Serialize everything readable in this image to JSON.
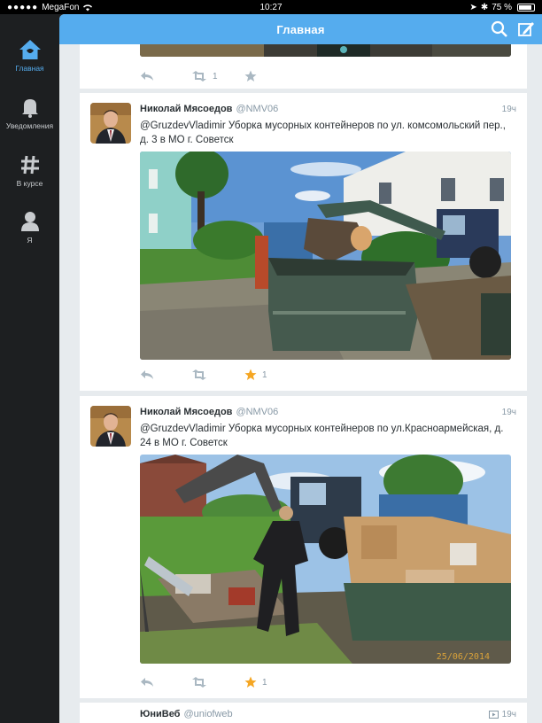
{
  "status_bar": {
    "carrier": "MegaFon",
    "time": "10:27",
    "battery": "75 %",
    "battery_level": 0.75
  },
  "sidebar": {
    "items": [
      {
        "label": "Главная",
        "icon": "home-icon",
        "active": true
      },
      {
        "label": "Уведомления",
        "icon": "bell-icon",
        "active": false
      },
      {
        "label": "В курсе",
        "icon": "hashtag-icon",
        "active": false
      },
      {
        "label": "Я",
        "icon": "person-icon",
        "active": false
      }
    ]
  },
  "header": {
    "title": "Главная",
    "icons": [
      "search-icon",
      "compose-icon"
    ]
  },
  "timeline": {
    "top_tweet": {
      "retweets": "1"
    },
    "tweets": [
      {
        "author": "Николай Мясоедов",
        "handle": "@NMV06",
        "time": "19ч",
        "text": "@GruzdevVladimir  Уборка мусорных контейнеров по ул. комсомольский пер., д. 3 в МО г. Советск",
        "favorites": "1"
      },
      {
        "author": "Николай Мясоедов",
        "handle": "@NMV06",
        "time": "19ч",
        "text": "@GruzdevVladimir  Уборка мусорных контейнеров по ул.Красноармейская, д. 24 в МО г. Советск",
        "favorites": "1",
        "photo_date": "25/06/2014"
      }
    ],
    "bottom_tweet": {
      "author": "ЮниВеб",
      "handle": "@uniofweb",
      "time": "19ч"
    }
  },
  "colors": {
    "accent": "#55acee",
    "sidebar_bg": "#1d1f21",
    "favorite_star": "#f5a623",
    "timeline_bg": "#e7ebee"
  }
}
